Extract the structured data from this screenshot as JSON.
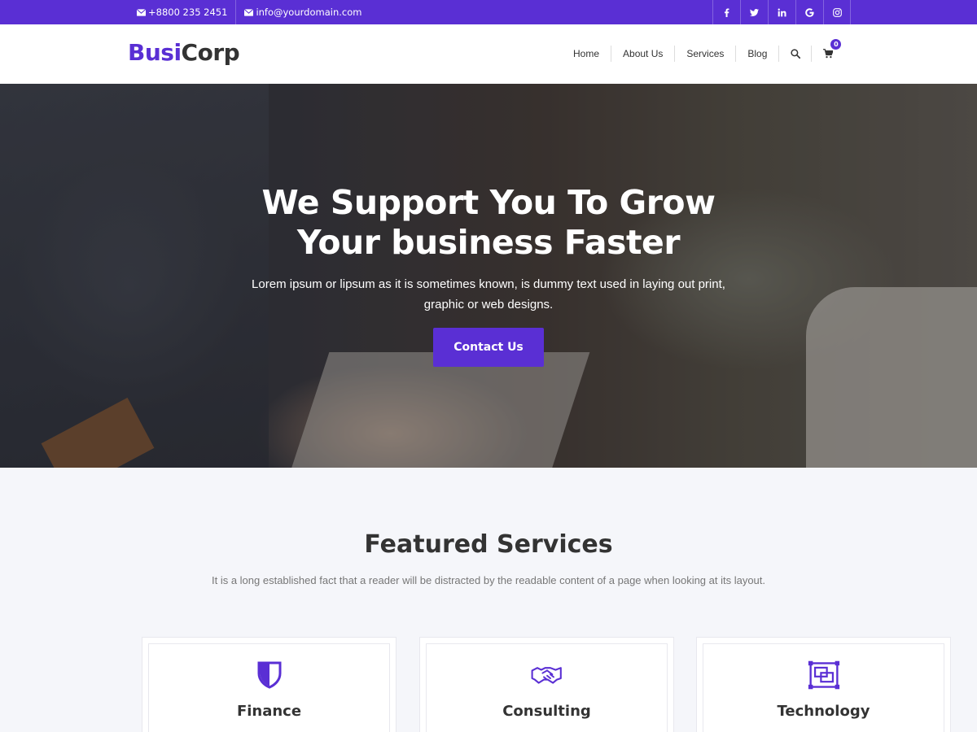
{
  "topbar": {
    "phone": "+8800 235 2451",
    "email": "info@yourdomain.com",
    "socials": [
      "facebook-icon",
      "twitter-icon",
      "linkedin-icon",
      "google-icon",
      "instagram-icon"
    ],
    "social_glyphs": [
      "f",
      "🐦",
      "in",
      "G",
      "◎"
    ]
  },
  "header": {
    "logo_part1": "Busi",
    "logo_part2": "Corp",
    "nav": [
      {
        "label": "Home"
      },
      {
        "label": "About Us"
      },
      {
        "label": "Services"
      },
      {
        "label": "Blog"
      }
    ],
    "cart_count": "0"
  },
  "hero": {
    "title_line1": "We Support You To Grow",
    "title_line2": "Your business Faster",
    "text": "Lorem ipsum or lipsum as it is sometimes known, is dummy text used in laying out print, graphic or web designs.",
    "button": "Contact Us"
  },
  "featured": {
    "title": "Featured Services",
    "subtitle": "It is a long established fact that a reader will be distracted by the readable content of a page when looking at its layout.",
    "cards": [
      {
        "title": "Finance",
        "icon": "shield-icon"
      },
      {
        "title": "Consulting",
        "icon": "handshake-icon"
      },
      {
        "title": "Technology",
        "icon": "technology-icon"
      }
    ]
  },
  "colors": {
    "accent": "#5a2fd4",
    "text": "#333333",
    "section_bg": "#f5f6fa"
  }
}
